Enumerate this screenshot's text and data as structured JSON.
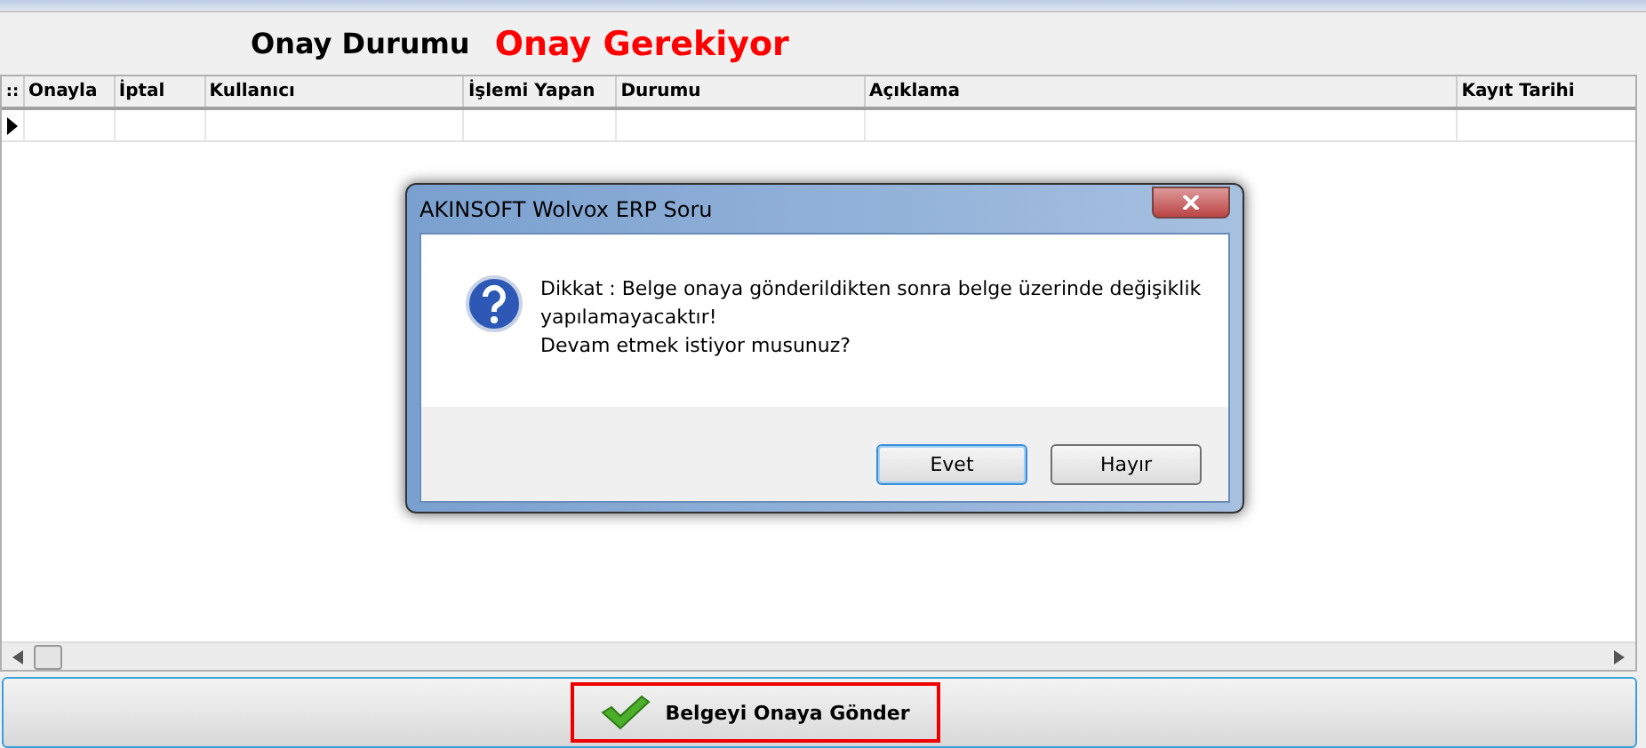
{
  "header": {
    "label": "Onay Durumu",
    "status": "Onay Gerekiyor"
  },
  "grid": {
    "indicator": "::",
    "columns": [
      "Onayla",
      "İptal",
      "Kullanıcı",
      "İşlemi Yapan",
      "Durumu",
      "Açıklama",
      "Kayıt Tarihi"
    ]
  },
  "dialog": {
    "title": "AKINSOFT Wolvox ERP Soru",
    "message": [
      "Dikkat : Belge onaya gönderildikten sonra belge üzerinde değişiklik",
      "yapılamayacaktır!",
      "Devam etmek istiyor musunuz?"
    ],
    "buttons": [
      {
        "label": "Evet",
        "selected": true
      },
      {
        "label": "Hayır",
        "selected": false
      }
    ]
  },
  "action_button": {
    "label": "Belgeyi Onaya Gönder"
  }
}
